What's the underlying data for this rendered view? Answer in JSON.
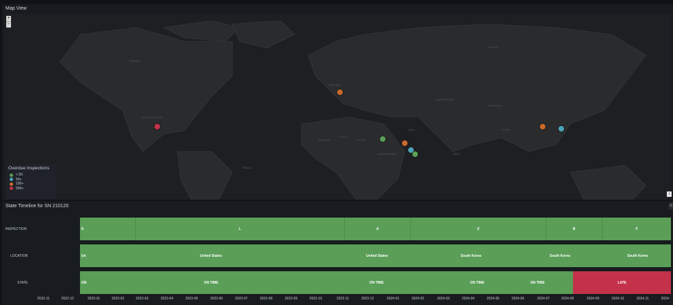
{
  "map_panel": {
    "title": "Map View",
    "zoom_in": "+",
    "zoom_out": "−",
    "legend": {
      "title": "Overdue Inspections",
      "items": [
        {
          "label": "< 50",
          "color": "#5a9e57"
        },
        {
          "label": "50+",
          "color": "#4aa3b8"
        },
        {
          "label": "100+",
          "color": "#c86a2c"
        },
        {
          "label": "500+",
          "color": "#c4314b"
        }
      ]
    },
    "map_labels": [
      "UNITED STATES",
      "FINLAND",
      "KAZAKHSTAN",
      "MONGOLIA",
      "CHINA",
      "INDIA",
      "EGYPT",
      "SAUDI ARABIA",
      "IRAN",
      "RUSSIA",
      "ALGERIA",
      "LIBYA",
      "BRAZIL",
      "CANADA"
    ],
    "info_button": "i"
  },
  "timeline_panel": {
    "title": "State Timeline for SN 210120",
    "menu_icon": "≡",
    "rows": [
      {
        "label": "INSPECTION",
        "segments": [
          {
            "text": "K",
            "color": "#5a9e57"
          },
          {
            "text": "L",
            "color": "#5a9e57"
          },
          {
            "text": "A",
            "color": "#5a9e57"
          },
          {
            "text": "X",
            "color": "#5a9e57"
          },
          {
            "text": "B",
            "color": "#5a9e57"
          },
          {
            "text": "F",
            "color": "#5a9e57"
          }
        ]
      },
      {
        "label": "LOCATION",
        "segments": [
          {
            "text": "Un",
            "color": "#5a9e57"
          },
          {
            "text": "United States",
            "color": "#5a9e57"
          },
          {
            "text": "United States",
            "color": "#5a9e57"
          },
          {
            "text": "South Korea",
            "color": "#5a9e57"
          },
          {
            "text": "South Korea",
            "color": "#5a9e57"
          },
          {
            "text": "South Korea",
            "color": "#5a9e57"
          }
        ]
      },
      {
        "label": "STATE",
        "segments": [
          {
            "text": "ON",
            "color": "#5a9e57"
          },
          {
            "text": "ON TIME",
            "color": "#5a9e57"
          },
          {
            "text": "ON TIME",
            "color": "#5a9e57"
          },
          {
            "text": "ON TIME",
            "color": "#5a9e57"
          },
          {
            "text": "ON TIME",
            "color": "#5a9e57"
          },
          {
            "text": "LATE",
            "color": "#c4314b"
          }
        ]
      }
    ],
    "x_axis": [
      "2022-11",
      "2022-12",
      "2023-01",
      "2023-02",
      "2023-03",
      "2023-04",
      "2023-05",
      "2023-06",
      "2023-07",
      "2023-08",
      "2023-09",
      "2023-10",
      "2023-11",
      "2023-12",
      "2024-01",
      "2024-02",
      "2024-03",
      "2024-04",
      "2024-05",
      "2024-06",
      "2024-07",
      "2024-08",
      "2024-09",
      "2024-10",
      "2024-11",
      "2024-"
    ]
  }
}
